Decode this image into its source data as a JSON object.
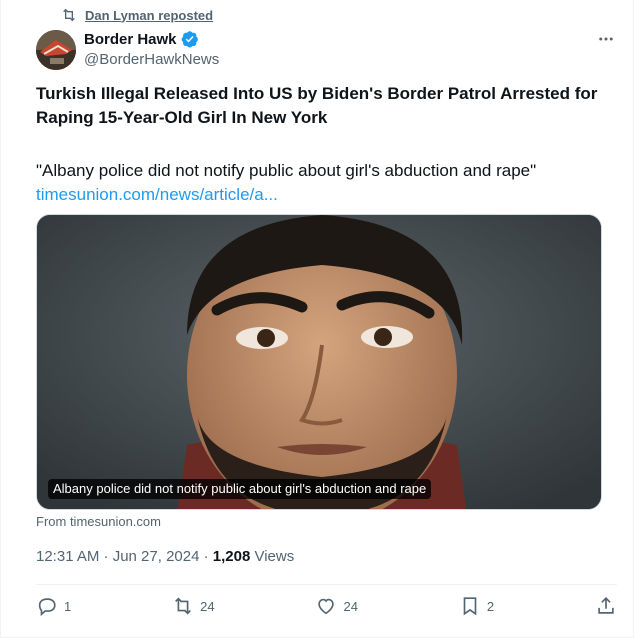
{
  "repost": {
    "icon": "repost-icon",
    "text": "Dan Lyman reposted"
  },
  "author": {
    "name": "Border Hawk",
    "handle": "@BorderHawkNews",
    "verified_icon": "verified-badge-icon"
  },
  "more_icon": "more-options-icon",
  "post": {
    "headline": "Turkish Illegal Released Into US by Biden's Border Patrol Arrested for Raping 15-Year-Old Girl In New York",
    "quote": "\"Albany police did not notify public about girl's abduction and rape\"",
    "link": "timesunion.com/news/article/a..."
  },
  "media": {
    "caption": "Albany police did not notify public about girl's abduction and rape",
    "source": "From timesunion.com"
  },
  "meta": {
    "time": "12:31 AM · Jun 27, 2024 · ",
    "views_count": "1,208",
    "views_label": " Views"
  },
  "actions": {
    "replies": "1",
    "reposts": "24",
    "likes": "24",
    "bookmarks": "2"
  },
  "colors": {
    "accent": "#1d9bf0",
    "secondary_text": "#536471",
    "primary_text": "#0f1419"
  }
}
